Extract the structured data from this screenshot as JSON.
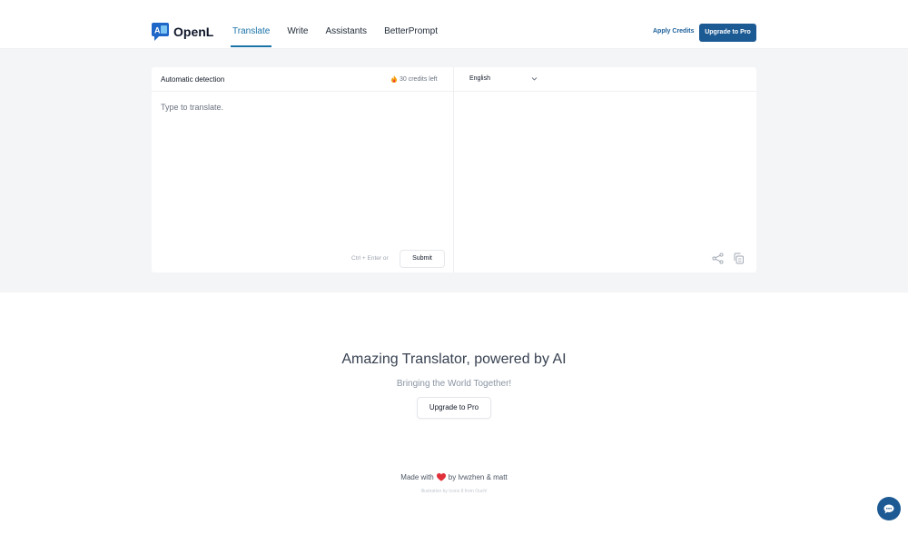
{
  "app": {
    "name": "OpenL",
    "logo_mark": "A文"
  },
  "nav": {
    "items": [
      {
        "label": "Translate",
        "active": true
      },
      {
        "label": "Write",
        "active": false
      },
      {
        "label": "Assistants",
        "active": false
      },
      {
        "label": "BetterPrompt",
        "active": false
      }
    ]
  },
  "header": {
    "apply_credits": "Apply Credits",
    "upgrade": "Upgrade to Pro"
  },
  "translator": {
    "source_language": "Automatic detection",
    "credits_left": "30 credits left",
    "target_language": "English",
    "input_placeholder": "Type to translate.",
    "input_value": "",
    "shortcut_hint": "Ctrl + Enter or",
    "submit_label": "Submit",
    "output_text": ""
  },
  "hero": {
    "title": "Amazing Translator, powered by AI",
    "subtitle": "Bringing the World Together!",
    "button": "Upgrade to Pro"
  },
  "footer": {
    "made_with": "Made with",
    "by_text": "by lvwzhen & matt",
    "credit": "Illustration by Icons 8 from Ouch!"
  },
  "icons": {
    "fire": "fire-icon",
    "chevron": "chevron-down-icon",
    "share": "share-icon",
    "copy": "copy-icon",
    "heart": "heart-icon",
    "chat": "chat-icon"
  },
  "colors": {
    "brand": "#1c5a94",
    "accent": "#1a73a8",
    "heart": "#e0303a"
  }
}
